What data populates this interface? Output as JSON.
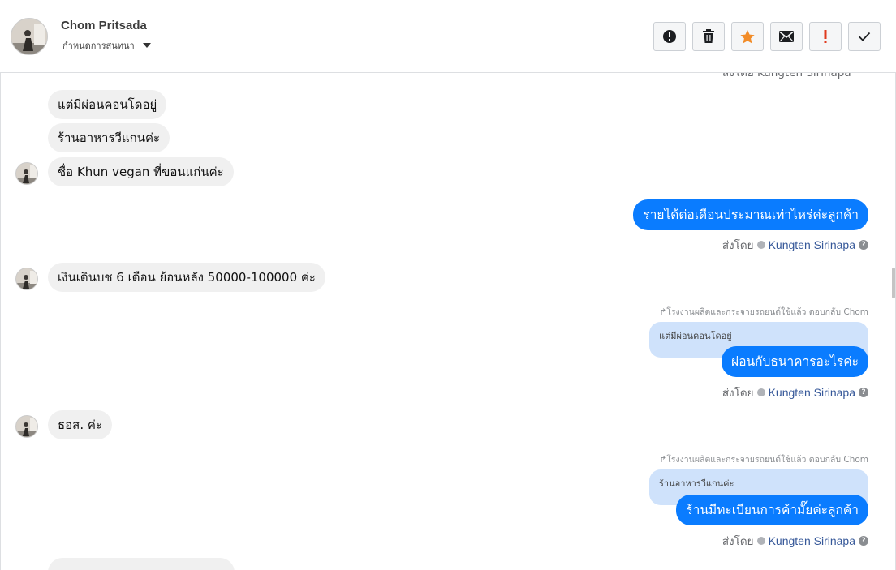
{
  "header": {
    "contact_name": "Chom Pritsada",
    "subtitle": "กำหนดการสนทนา"
  },
  "actions": [
    {
      "name": "spam-button",
      "icon": "alert-circle-icon"
    },
    {
      "name": "delete-button",
      "icon": "trash-icon"
    },
    {
      "name": "star-button",
      "icon": "star-icon"
    },
    {
      "name": "mark-unread-button",
      "icon": "envelope-icon"
    },
    {
      "name": "important-button",
      "icon": "exclamation-icon"
    },
    {
      "name": "done-button",
      "icon": "checkmark-icon"
    }
  ],
  "thread": {
    "partial_top_text": "ส่งโดย Kungten Sirinapa",
    "msg1": "แต่มีผ่อนคอนโดอยู่",
    "msg2": "ร้านอาหารวีแกนค่ะ",
    "msg3": "ชื่อ Khun vegan ที่ขอนแก่นค่ะ",
    "out1": "รายได้ต่อเดือนประมาณเท่าไหร่ค่ะลูกค้า",
    "sent_by_label": "ส่งโดย",
    "agent_name": "Kungten Sirinapa",
    "msg4": "เงินเดินบช 6 เดือน ย้อนหลัง 50000-100000 ค่ะ",
    "reply_label": "โรงงานผลิตและกระจายรถยนต์ใช้แล้ว ตอบกลับ Chom",
    "quote1": "แต่มีผ่อนคอนโดอยู่",
    "out2": "ผ่อนกับธนาคารอะไรค่ะ",
    "msg5": "ธอส. ค่ะ",
    "quote2": "ร้านอาหารวีแกนค่ะ",
    "out3": "ร้านมีทะเบียนการค้ามั๊ยค่ะลูกค้า"
  },
  "colors": {
    "outgoing_bubble": "#0a7cff",
    "incoming_bubble": "#f0f0f0",
    "quote_bubble": "#cfe2fb",
    "agent_link": "#365899",
    "star": "#f28c28",
    "important": "#e03a1e"
  }
}
